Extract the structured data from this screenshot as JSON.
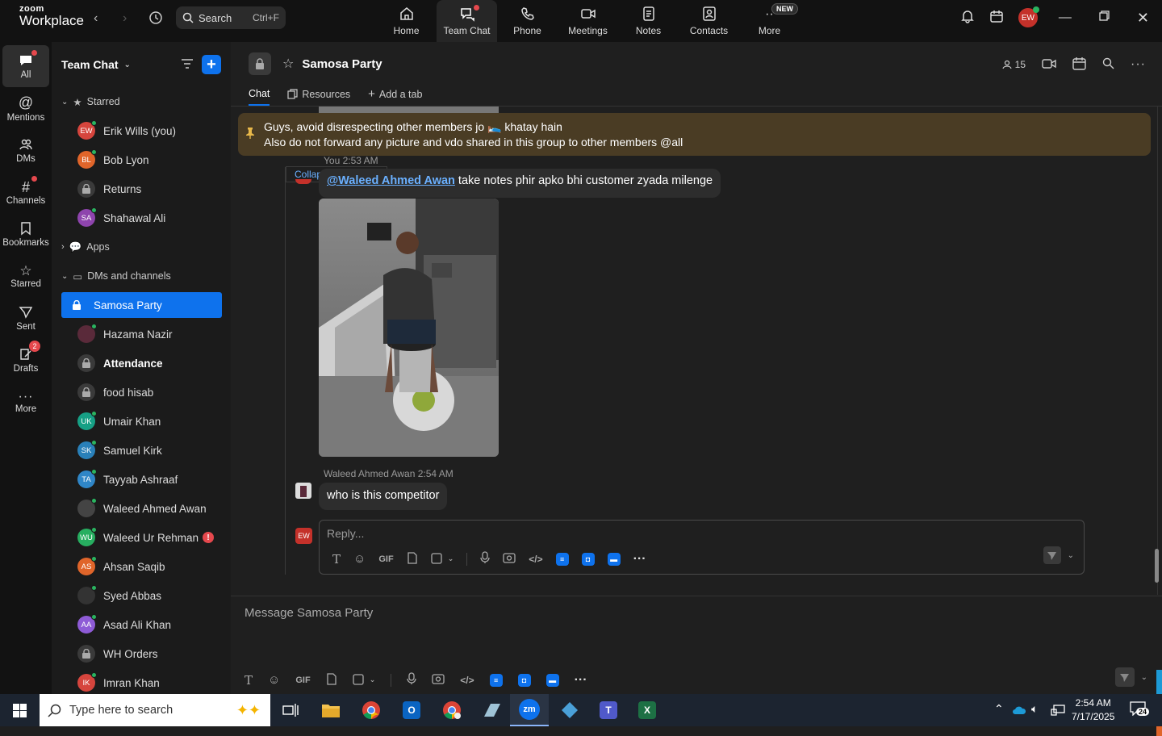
{
  "topbar": {
    "brand_top": "zoom",
    "brand_bottom": "Workplace",
    "search_label": "Search",
    "search_shortcut": "Ctrl+F",
    "nav": [
      {
        "label": "Home",
        "icon": "home-icon"
      },
      {
        "label": "Team Chat",
        "icon": "team-chat-icon",
        "active": true
      },
      {
        "label": "Phone",
        "icon": "phone-icon"
      },
      {
        "label": "Meetings",
        "icon": "video-icon"
      },
      {
        "label": "Notes",
        "icon": "notes-icon"
      },
      {
        "label": "Contacts",
        "icon": "contacts-icon"
      },
      {
        "label": "More",
        "icon": "more-icon",
        "badge": "NEW"
      }
    ],
    "user_initials": "EW"
  },
  "rail": [
    {
      "label": "All",
      "active": true
    },
    {
      "label": "Mentions"
    },
    {
      "label": "DMs"
    },
    {
      "label": "Channels"
    },
    {
      "label": "Bookmarks"
    },
    {
      "label": "Starred"
    },
    {
      "label": "Sent"
    },
    {
      "label": "Drafts",
      "badge": "2"
    },
    {
      "label": "More"
    }
  ],
  "sidebar": {
    "title": "Team Chat",
    "sections": {
      "starred": "Starred",
      "apps": "Apps",
      "dms": "DMs and channels"
    },
    "starred": [
      {
        "name": "Erik Wills (you)",
        "initials": "EW",
        "color": "#d6453d"
      },
      {
        "name": "Bob Lyon",
        "initials": "BL",
        "color": "#e0652a"
      },
      {
        "name": "Returns",
        "locked": true
      },
      {
        "name": "Shahawal Ali",
        "initials": "SA",
        "color": "#8e44ad"
      }
    ],
    "dms": [
      {
        "name": "Samosa Party",
        "locked": true,
        "selected": true
      },
      {
        "name": "Hazama Nazir",
        "initials": "",
        "color": "#5a2a3a"
      },
      {
        "name": "Attendance",
        "locked": true,
        "bold": true
      },
      {
        "name": "food hisab",
        "locked": true
      },
      {
        "name": "Umair Khan",
        "initials": "UK",
        "color": "#16a085"
      },
      {
        "name": "Samuel Kirk",
        "initials": "SK",
        "color": "#2980b9"
      },
      {
        "name": "Tayyab Ashraaf",
        "initials": "TA",
        "color": "#2f86c7"
      },
      {
        "name": "Waleed Ahmed Awan",
        "initials": "",
        "color": "#444"
      },
      {
        "name": "Waleed Ur Rehman",
        "initials": "WU",
        "color": "#27ae60",
        "alert": "!"
      },
      {
        "name": "Ahsan Saqib",
        "initials": "AS",
        "color": "#e0652a"
      },
      {
        "name": "Syed Abbas",
        "initials": "",
        "color": "#333"
      },
      {
        "name": "Asad Ali Khan",
        "initials": "AA",
        "color": "#8e5bd6"
      },
      {
        "name": "WH Orders",
        "locked": true
      },
      {
        "name": "Imran Khan",
        "initials": "IK",
        "color": "#d6453d"
      }
    ]
  },
  "channel": {
    "title": "Samosa Party",
    "member_count": "15",
    "tabs": [
      "Chat",
      "Resources",
      "Add a tab"
    ]
  },
  "pinned": {
    "line1": "Guys, avoid disrespecting other members jo 🛌 khatay hain",
    "line2": "Also do not forward any picture and vdo shared in this group to other members @all"
  },
  "thread": {
    "collapse_label": "Collapse all",
    "msg1_meta": "You 2:53 AM",
    "msg1_mention": "@Waleed Ahmed Awan",
    "msg1_text": " take notes phir apko bhi customer zyada milenge",
    "msg2_meta": "Waleed Ahmed Awan 2:54 AM",
    "msg2_text": "who is this competitor",
    "reply_placeholder": "Reply...",
    "reply_avatar": "EW"
  },
  "compose": {
    "placeholder": "Message Samosa Party",
    "gif_label": "GIF"
  },
  "taskbar": {
    "search_placeholder": "Type here to search",
    "time": "2:54 AM",
    "date": "7/17/2025",
    "notif_count": "24"
  }
}
